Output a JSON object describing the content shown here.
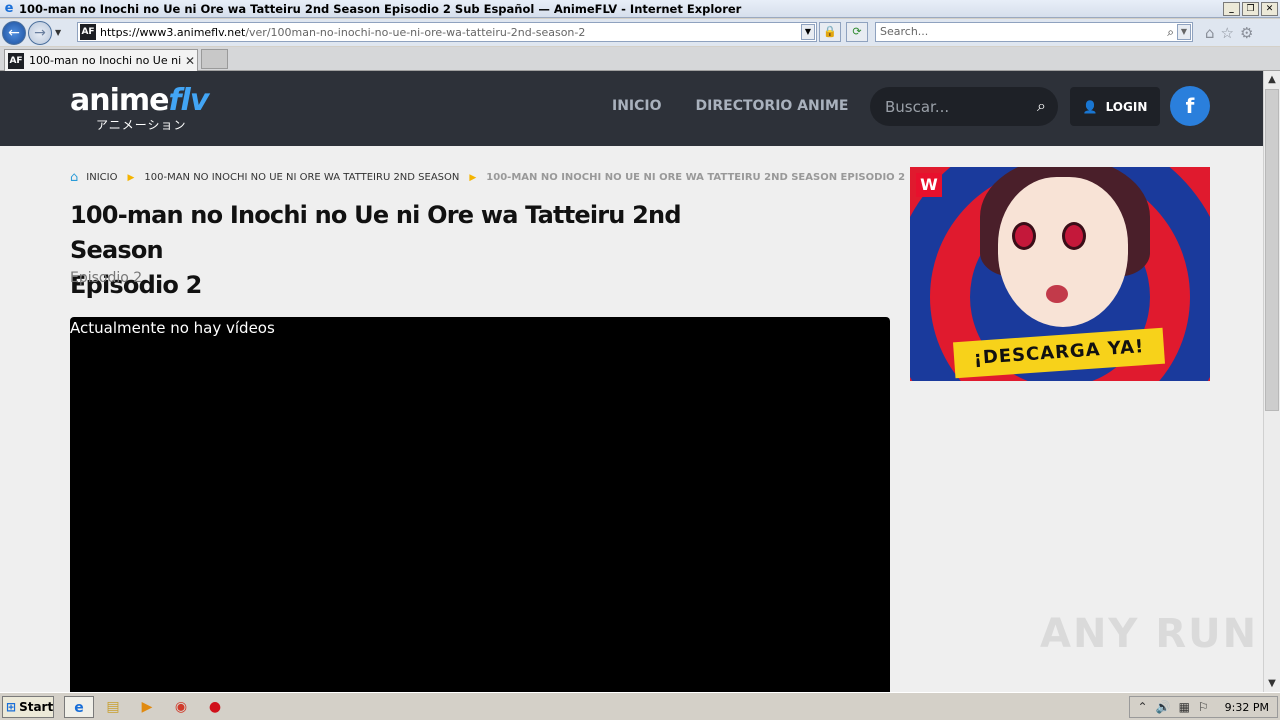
{
  "browser": {
    "window_title": "100-man no Inochi no Ue ni Ore wa Tatteiru 2nd Season Episodio 2 Sub Español — AnimeFLV - Internet Explorer",
    "url_scheme": "https://",
    "url_host": "www3.animeflv.net",
    "url_path": "/ver/100man-no-inochi-no-ue-ni-ore-wa-tatteiru-2nd-season-2",
    "search_placeholder": "Search...",
    "tab_label": "100-man no Inochi no Ue ni ...",
    "favicon_text": "AF"
  },
  "site": {
    "logo_main": "anime",
    "logo_accent": "flv",
    "logo_sub": "アニメーション",
    "nav": [
      "INICIO",
      "DIRECTORIO ANIME"
    ],
    "search_placeholder": "Buscar...",
    "login_label": "LOGIN",
    "facebook_label": "f"
  },
  "breadcrumb": {
    "items": [
      "INICIO",
      "100-MAN NO INOCHI NO UE NI ORE WA TATTEIRU 2ND SEASON"
    ],
    "current": "100-MAN NO INOCHI NO UE NI ORE WA TATTEIRU 2ND SEASON EPISODIO 2"
  },
  "episode": {
    "title_line1": "100-man no Inochi no Ue ni Ore wa Tatteiru 2nd Season",
    "title_line2": "Episodio 2",
    "subtitle": "Episodio 2",
    "no_video_text": "Actualmente no hay vídeos"
  },
  "ad": {
    "brand": "W",
    "cta": "¡DESCARGA YA!"
  },
  "watermark": "ANY RUN",
  "taskbar": {
    "start_label": "Start",
    "clock": "9:32 PM"
  },
  "colors": {
    "header_bg": "#2d3139",
    "accent_blue": "#42a5f5",
    "breadcrumb_sep": "#f5b400",
    "facebook": "#2a7fdc",
    "cta_yellow": "#f7d21a"
  }
}
